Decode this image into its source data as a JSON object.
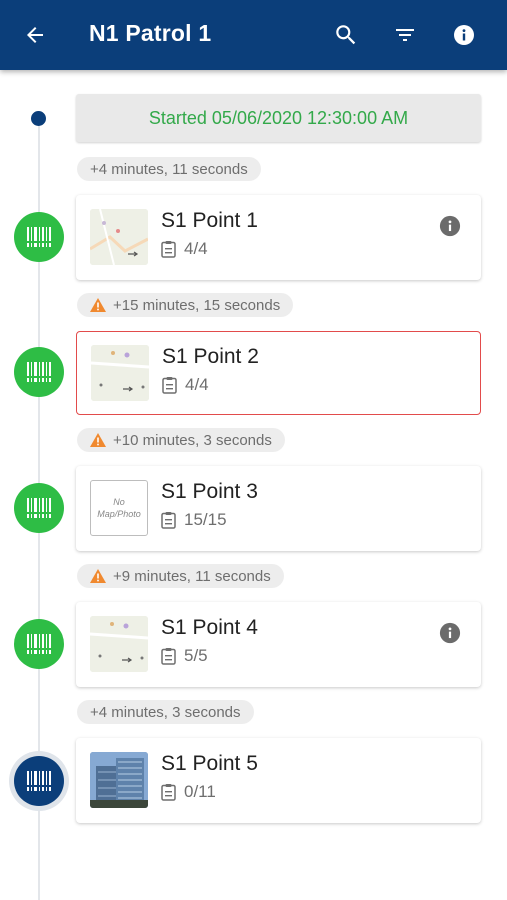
{
  "header": {
    "title": "N1 Patrol 1",
    "background": "#0b3e7a",
    "icons": [
      "arrow-left-icon",
      "search-icon",
      "filter-icon",
      "info-icon"
    ]
  },
  "timeline": {
    "started_label": "Started 05/06/2020 12:30:00 AM",
    "started_color": "#33a94a",
    "intervals": [
      {
        "text": "+4 minutes, 11 seconds",
        "warning": false
      },
      {
        "text": "+15 minutes, 15 seconds",
        "warning": true
      },
      {
        "text": "+10 minutes, 3 seconds",
        "warning": true
      },
      {
        "text": "+9 minutes, 11 seconds",
        "warning": true
      },
      {
        "text": "+4 minutes, 3 seconds",
        "warning": false
      }
    ],
    "points": [
      {
        "name": "S1 Point 1",
        "count": "4/4",
        "thumb": "map",
        "info": true,
        "alert": false,
        "marker": "green"
      },
      {
        "name": "S1 Point 2",
        "count": "4/4",
        "thumb": "map",
        "info": false,
        "alert": true,
        "marker": "green"
      },
      {
        "name": "S1 Point 3",
        "count": "15/15",
        "thumb": "none",
        "thumb_text_1": "No",
        "thumb_text_2": "Map/Photo",
        "info": false,
        "alert": false,
        "marker": "green"
      },
      {
        "name": "S1 Point 4",
        "count": "5/5",
        "thumb": "map",
        "info": true,
        "alert": false,
        "marker": "green"
      },
      {
        "name": "S1 Point 5",
        "count": "0/11",
        "thumb": "photo",
        "info": false,
        "alert": false,
        "marker": "blue"
      }
    ]
  },
  "colors": {
    "completed_marker": "#2ebd45",
    "current_marker": "#0b3e7a",
    "alert_border": "#e24b4b",
    "warning": "#f0892f"
  }
}
